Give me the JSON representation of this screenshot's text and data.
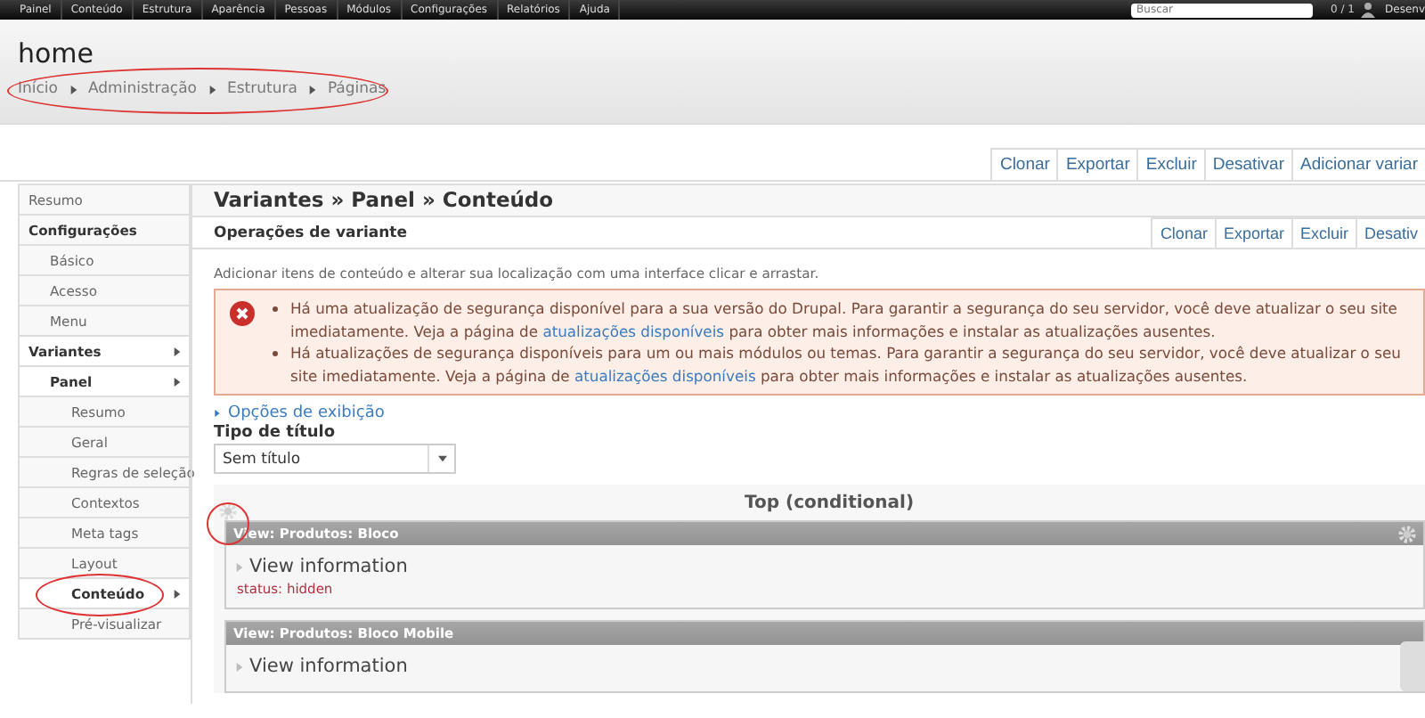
{
  "toolbar": {
    "items": [
      "Painel",
      "Conteúdo",
      "Estrutura",
      "Aparência",
      "Pessoas",
      "Módulos",
      "Configurações",
      "Relatórios",
      "Ajuda"
    ],
    "search": {
      "placeholder": "Buscar"
    },
    "counter": "0 / 1",
    "user": "Desenv"
  },
  "header": {
    "title": "home",
    "breadcrumb": [
      "Início",
      "Administração",
      "Estrutura",
      "Páginas"
    ]
  },
  "page_actions": [
    "Clonar",
    "Exportar",
    "Excluir",
    "Desativar",
    "Adicionar variar"
  ],
  "sidebar": {
    "items": [
      {
        "label": "Resumo",
        "selected": false
      },
      {
        "label": "Configurações",
        "selected": false,
        "children": [
          {
            "label": "Básico",
            "selected": false
          },
          {
            "label": "Acesso",
            "selected": false
          },
          {
            "label": "Menu",
            "selected": false
          }
        ]
      },
      {
        "label": "Variantes",
        "selected": true,
        "children": [
          {
            "label": "Panel",
            "selected": true,
            "children": [
              {
                "label": "Resumo",
                "selected": false
              },
              {
                "label": "Geral",
                "selected": false
              },
              {
                "label": "Regras de seleção",
                "selected": false
              },
              {
                "label": "Contextos",
                "selected": false
              },
              {
                "label": "Meta tags",
                "selected": false
              },
              {
                "label": "Layout",
                "selected": false
              },
              {
                "label": "Conteúdo",
                "selected": true
              },
              {
                "label": "Pré-visualizar",
                "selected": false
              }
            ]
          }
        ]
      }
    ]
  },
  "main": {
    "title": "Variantes » Panel » Conteúdo",
    "operations": {
      "label": "Operações de variante",
      "actions": [
        "Clonar",
        "Exportar",
        "Excluir",
        "Desativ"
      ]
    },
    "description": "Adicionar itens de conteúdo e alterar sua localização com uma interface clicar e arrastar.",
    "errors": [
      {
        "before": "Há uma atualização de segurança disponível para a sua versão do Drupal. Para garantir a segurança do seu servidor, você deve atualizar o seu site imediatamente. Veja a página de",
        "link": "atualizações disponíveis",
        "after": "para obter mais informações e instalar as atualizações ausentes."
      },
      {
        "before": "Há atualizações de segurança disponíveis para um ou mais módulos ou temas. Para garantir a segurança do seu servidor, você deve atualizar o seu site imediatamente. Veja a página de",
        "link": "atualizações disponíveis",
        "after": "para obter mais informações e instalar as atualizações ausentes."
      }
    ],
    "display_options": {
      "label": "Opções de exibição",
      "expanded": false
    },
    "title_type": {
      "label": "Tipo de título",
      "value": "Sem título"
    },
    "region": {
      "title": "Top (conditional)",
      "panes": [
        {
          "title": "View: Produtos: Bloco",
          "info": "View information",
          "status": "status: hidden"
        },
        {
          "title": "View: Produtos: Bloco Mobile",
          "info": "View information"
        }
      ]
    }
  }
}
